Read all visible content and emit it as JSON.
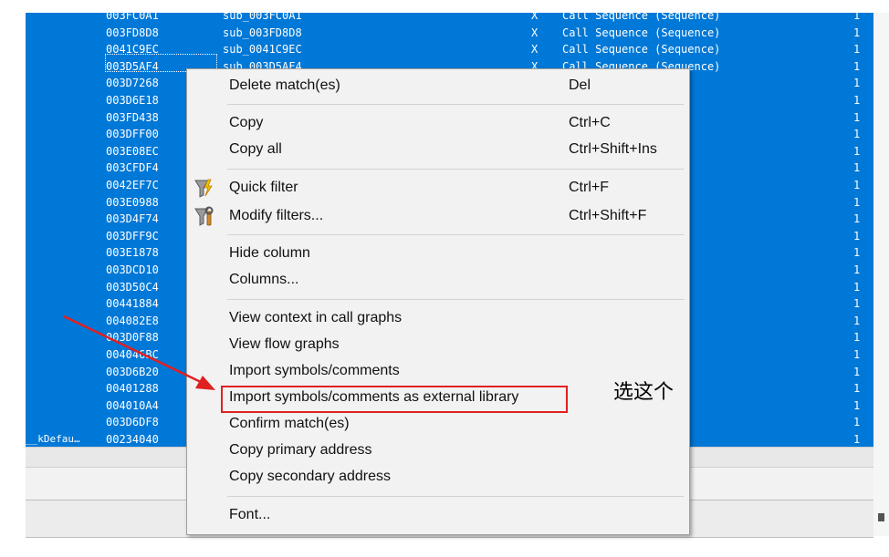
{
  "rows": [
    {
      "prefix": "",
      "addr": "003FC0A1",
      "name": "sub_003FC0A1",
      "x": "X",
      "type": "Call Sequence (Sequence)",
      "n": "1"
    },
    {
      "prefix": "",
      "addr": "003FD8D8",
      "name": "sub_003FD8D8",
      "x": "X",
      "type": "Call Sequence (Sequence)",
      "n": "1"
    },
    {
      "prefix": "",
      "addr": "0041C9EC",
      "name": "sub_0041C9EC",
      "x": "X",
      "type": "Call Sequence (Sequence)",
      "n": "1"
    },
    {
      "prefix": "",
      "addr": "003D5AF4",
      "name": "sub_003D5AF4",
      "x": "X",
      "type": "Call Sequence (Sequence)",
      "n": "1"
    },
    {
      "prefix": "",
      "addr": "003D7268",
      "name": "",
      "x": "",
      "type": "quence)",
      "n": "1"
    },
    {
      "prefix": "",
      "addr": "003D6E18",
      "name": "",
      "x": "",
      "type": "quence)",
      "n": "1"
    },
    {
      "prefix": "",
      "addr": "003FD438",
      "name": "",
      "x": "",
      "type": "quence)",
      "n": "1"
    },
    {
      "prefix": "",
      "addr": "003DFF00",
      "name": "",
      "x": "",
      "type": "quence)",
      "n": "1"
    },
    {
      "prefix": "",
      "addr": "003E08EC",
      "name": "",
      "x": "",
      "type": "quence)",
      "n": "1"
    },
    {
      "prefix": "",
      "addr": "003CFDF4",
      "name": "",
      "x": "",
      "type": "quence)",
      "n": "1"
    },
    {
      "prefix": "",
      "addr": "0042EF7C",
      "name": "",
      "x": "",
      "type": "quence)",
      "n": "1"
    },
    {
      "prefix": "",
      "addr": "003E0988",
      "name": "",
      "x": "",
      "type": "quence)",
      "n": "1"
    },
    {
      "prefix": "",
      "addr": "003D4F74",
      "name": "",
      "x": "",
      "type": "quence)",
      "n": "1"
    },
    {
      "prefix": "",
      "addr": "003DFF9C",
      "name": "",
      "x": "",
      "type": "quence)",
      "n": "1"
    },
    {
      "prefix": "",
      "addr": "003E1878",
      "name": "",
      "x": "",
      "type": "quence)",
      "n": "1"
    },
    {
      "prefix": "",
      "addr": "003DCD10",
      "name": "",
      "x": "",
      "type": "quence)",
      "n": "1"
    },
    {
      "prefix": "",
      "addr": "003D50C4",
      "name": "",
      "x": "",
      "type": "quence)",
      "n": "1"
    },
    {
      "prefix": "",
      "addr": "00441884",
      "name": "",
      "x": "",
      "type": "quence)",
      "n": "1"
    },
    {
      "prefix": "",
      "addr": "004082E8",
      "name": "",
      "x": "",
      "type": "quence)",
      "n": "1"
    },
    {
      "prefix": "",
      "addr": "003D0F88",
      "name": "",
      "x": "",
      "type": "quence)",
      "n": "1"
    },
    {
      "prefix": "",
      "addr": "004046BC",
      "name": "",
      "x": "",
      "type": "quence)",
      "n": "1"
    },
    {
      "prefix": "",
      "addr": "003D6B20",
      "name": "",
      "x": "",
      "type": "quence)",
      "n": "1"
    },
    {
      "prefix": "",
      "addr": "00401288",
      "name": "",
      "x": "",
      "type": "quence)",
      "n": "1"
    },
    {
      "prefix": "",
      "addr": "004010A4",
      "name": "",
      "x": "",
      "type": "quence)",
      "n": "1"
    },
    {
      "prefix": "",
      "addr": "003D6DF8",
      "name": "",
      "x": "",
      "type": "quence)",
      "n": "1"
    },
    {
      "prefix": "__kDefau…",
      "addr": "00234040",
      "name": "",
      "x": "",
      "type": "quence)",
      "n": "1"
    }
  ],
  "menu": {
    "delete_match": {
      "label": "Delete match(es)",
      "shortcut": "Del"
    },
    "copy": {
      "label": "Copy",
      "shortcut": "Ctrl+C"
    },
    "copy_all": {
      "label": "Copy all",
      "shortcut": "Ctrl+Shift+Ins"
    },
    "quick_filter": {
      "label": "Quick filter",
      "shortcut": "Ctrl+F",
      "icon": "filter-lightning-icon"
    },
    "modify_filters": {
      "label": "Modify filters...",
      "shortcut": "Ctrl+Shift+F",
      "icon": "filter-wrench-icon"
    },
    "hide_column": {
      "label": "Hide column"
    },
    "columns": {
      "label": "Columns..."
    },
    "view_context": {
      "label": "View context in call graphs"
    },
    "view_flow": {
      "label": "View flow graphs"
    },
    "import_symbols": {
      "label": "Import symbols/comments"
    },
    "import_symbols_ext": {
      "label": "Import symbols/comments as external library"
    },
    "confirm_match": {
      "label": "Confirm match(es)"
    },
    "copy_primary": {
      "label": "Copy primary address"
    },
    "copy_secondary": {
      "label": "Copy secondary address"
    },
    "font": {
      "label": "Font..."
    }
  },
  "annotation": {
    "text": "选这个"
  },
  "colors": {
    "selection": "#0078d7",
    "highlight": "#e02020",
    "menu_bg": "#f2f2f2"
  }
}
